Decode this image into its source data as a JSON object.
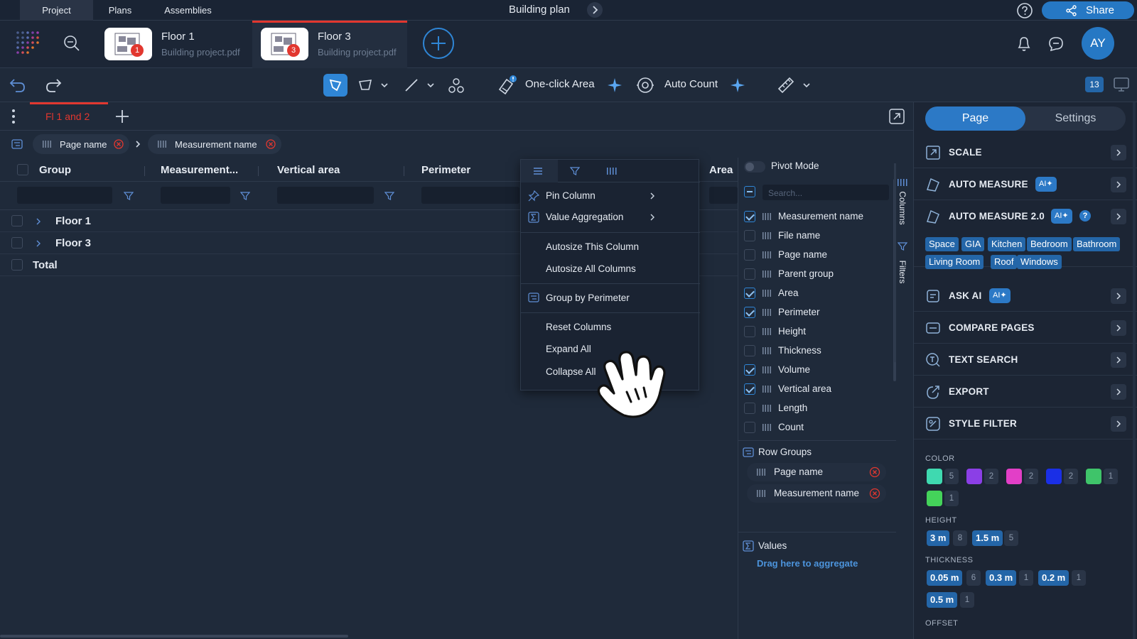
{
  "topbar": {
    "tabs": [
      {
        "label": "Project",
        "active": true
      },
      {
        "label": "Plans",
        "active": false
      },
      {
        "label": "Assemblies",
        "active": false
      }
    ],
    "title": "Building plan",
    "share_label": "Share"
  },
  "docs": [
    {
      "name": "Floor 1",
      "file": "Building project.pdf",
      "badge": "1"
    },
    {
      "name": "Floor 3",
      "file": "Building project.pdf",
      "badge": "3"
    }
  ],
  "user": {
    "initials": "AY"
  },
  "toolbar": {
    "one_click_label": "One-click Area",
    "auto_count_label": "Auto Count",
    "layers_count": "13"
  },
  "sheet_tab": {
    "label": "Fl 1 and 2"
  },
  "row_group_chips": [
    "Page name",
    "Measurement name"
  ],
  "grid": {
    "columns": [
      "Group",
      "Measurement...",
      "Vertical area",
      "Perimeter",
      "Area"
    ],
    "rows": [
      "Floor 1",
      "Floor 3"
    ],
    "total_label": "Total"
  },
  "column_menu": {
    "items": [
      "Pin Column",
      "Value Aggregation",
      "Autosize This Column",
      "Autosize All Columns",
      "Group by Perimeter",
      "Reset Columns",
      "Expand All",
      "Collapse All"
    ]
  },
  "columns_panel": {
    "pivot_label": "Pivot Mode",
    "search_placeholder": "Search...",
    "items": [
      {
        "label": "Measurement name",
        "checked": true
      },
      {
        "label": "File name",
        "checked": false
      },
      {
        "label": "Page name",
        "checked": false
      },
      {
        "label": "Parent group",
        "checked": false
      },
      {
        "label": "Area",
        "checked": true
      },
      {
        "label": "Perimeter",
        "checked": true
      },
      {
        "label": "Height",
        "checked": false
      },
      {
        "label": "Thickness",
        "checked": false
      },
      {
        "label": "Volume",
        "checked": true
      },
      {
        "label": "Vertical area",
        "checked": true
      },
      {
        "label": "Length",
        "checked": false
      },
      {
        "label": "Count",
        "checked": false
      }
    ],
    "row_groups_label": "Row Groups",
    "row_groups": [
      "Page name",
      "Measurement name"
    ],
    "values_label": "Values",
    "values_hint": "Drag here to aggregate",
    "side_tabs": [
      "Columns",
      "Filters"
    ]
  },
  "right_panel": {
    "segments": [
      "Page",
      "Settings"
    ],
    "sections": [
      {
        "label": "SCALE",
        "icon": "scale-icon"
      },
      {
        "label": "AUTO MEASURE",
        "icon": "auto-measure-icon",
        "ai": "AI"
      },
      {
        "label": "AUTO MEASURE 2.0",
        "icon": "auto-measure-2-icon",
        "ai": "AI",
        "help": "?"
      },
      {
        "label": "ASK AI",
        "icon": "ask-ai-icon",
        "ai": "AI"
      },
      {
        "label": "COMPARE PAGES",
        "icon": "compare-icon"
      },
      {
        "label": "TEXT SEARCH",
        "icon": "text-search-icon"
      },
      {
        "label": "EXPORT",
        "icon": "export-icon"
      },
      {
        "label": "STYLE FILTER",
        "icon": "style-filter-icon"
      }
    ],
    "auto_measure_tags": [
      "Space",
      "GIA",
      "Kitchen",
      "Bedroom",
      "Bathroom",
      "Living Room",
      "Roof",
      "Windows"
    ],
    "color_label": "COLOR",
    "colors": [
      {
        "hex": "#3fd9b0",
        "count": "5"
      },
      {
        "hex": "#8b3fe6",
        "count": "2"
      },
      {
        "hex": "#e23fc7",
        "count": "2"
      },
      {
        "hex": "#1a2fe6",
        "count": "2"
      },
      {
        "hex": "#3fc46a",
        "count": "1"
      },
      {
        "hex": "#44d35a",
        "count": "1"
      }
    ],
    "height_label": "HEIGHT",
    "heights": [
      {
        "value": "3 m",
        "count": "8"
      },
      {
        "value": "1.5 m",
        "count": "5"
      }
    ],
    "thickness_label": "THICKNESS",
    "thicknesses": [
      {
        "value": "0.05 m",
        "count": "6"
      },
      {
        "value": "0.3 m",
        "count": "1"
      },
      {
        "value": "0.2 m",
        "count": "1"
      },
      {
        "value": "0.5 m",
        "count": "1"
      }
    ],
    "offset_label": "OFFSET"
  },
  "colors": {
    "accent": "#2f86d6",
    "danger": "#e2372f",
    "bg": "#1f2a3a"
  }
}
